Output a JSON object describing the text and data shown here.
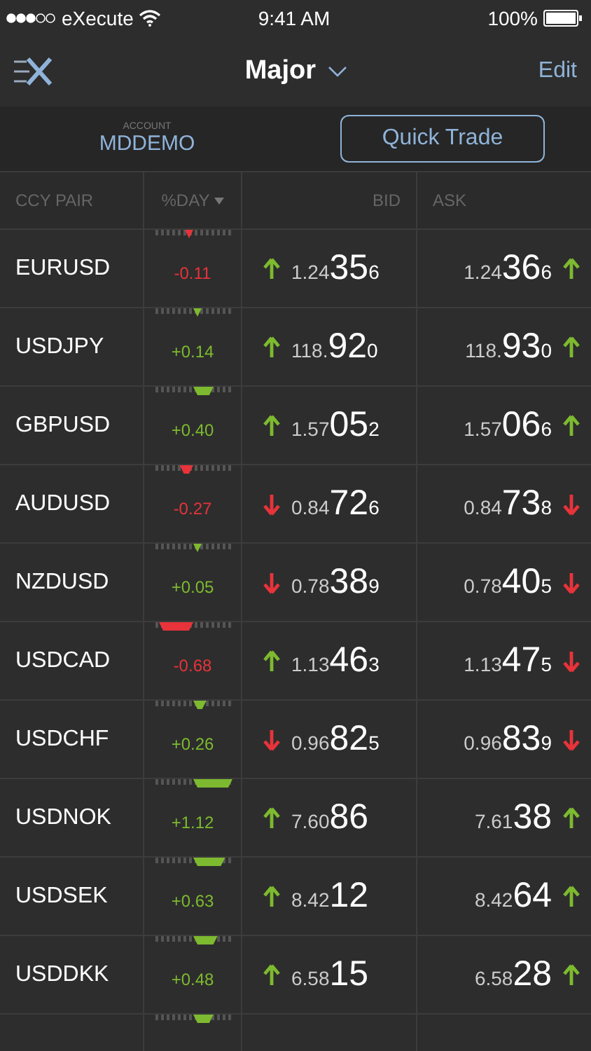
{
  "status_bar": {
    "carrier": "eXecute",
    "time": "9:41 AM",
    "battery": "100%"
  },
  "nav": {
    "title": "Major",
    "action": "Edit"
  },
  "account": {
    "label": "ACCOUNT",
    "name": "MDDEMO",
    "button": "Quick Trade"
  },
  "columns": [
    {
      "label": "CCY PAIR",
      "sorted": false
    },
    {
      "label": "%DAY",
      "sorted": true
    },
    {
      "label": "BID",
      "sorted": false
    },
    {
      "label": "ASK",
      "sorted": false
    }
  ],
  "rows": [
    {
      "pair": "EURUSD",
      "change": "-0.11",
      "negative": true,
      "bid": {
        "lead": "1.24",
        "big": "35",
        "tail": "6",
        "rising": true
      },
      "ask": {
        "lead": "1.24",
        "big": "36",
        "tail": "6",
        "rising": true
      }
    },
    {
      "pair": "USDJPY",
      "change": "+0.14",
      "negative": false,
      "bid": {
        "lead": "118.",
        "big": "92",
        "tail": "0",
        "rising": true
      },
      "ask": {
        "lead": "118.",
        "big": "93",
        "tail": "0",
        "rising": true
      }
    },
    {
      "pair": "GBPUSD",
      "change": "+0.40",
      "negative": false,
      "bid": {
        "lead": "1.57",
        "big": "05",
        "tail": "2",
        "rising": true
      },
      "ask": {
        "lead": "1.57",
        "big": "06",
        "tail": "6",
        "rising": true
      }
    },
    {
      "pair": "AUDUSD",
      "change": "-0.27",
      "negative": true,
      "bid": {
        "lead": "0.84",
        "big": "72",
        "tail": "6",
        "rising": false
      },
      "ask": {
        "lead": "0.84",
        "big": "73",
        "tail": "8",
        "rising": false
      }
    },
    {
      "pair": "NZDUSD",
      "change": "+0.05",
      "negative": false,
      "bid": {
        "lead": "0.78",
        "big": "38",
        "tail": "9",
        "rising": false
      },
      "ask": {
        "lead": "0.78",
        "big": "40",
        "tail": "5",
        "rising": false
      }
    },
    {
      "pair": "USDCAD",
      "change": "-0.68",
      "negative": true,
      "bid": {
        "lead": "1.13",
        "big": "46",
        "tail": "3",
        "rising": true
      },
      "ask": {
        "lead": "1.13",
        "big": "47",
        "tail": "5",
        "rising": false
      }
    },
    {
      "pair": "USDCHF",
      "change": "+0.26",
      "negative": false,
      "bid": {
        "lead": "0.96",
        "big": "82",
        "tail": "5",
        "rising": false
      },
      "ask": {
        "lead": "0.96",
        "big": "83",
        "tail": "9",
        "rising": false
      }
    },
    {
      "pair": "USDNOK",
      "change": "+1.12",
      "negative": false,
      "bid": {
        "lead": "7.60",
        "big": "86",
        "rising": true
      },
      "ask": {
        "lead": "7.61",
        "big": "38",
        "rising": true
      }
    },
    {
      "pair": "USDSEK",
      "change": "+0.63",
      "negative": false,
      "bid": {
        "lead": "8.42",
        "big": "12",
        "rising": true
      },
      "ask": {
        "lead": "8.42",
        "big": "64",
        "rising": true
      }
    },
    {
      "pair": "USDDKK",
      "change": "+0.48",
      "negative": false,
      "bid": {
        "lead": "6.58",
        "big": "15",
        "rising": true
      },
      "ask": {
        "lead": "6.58",
        "big": "28",
        "rising": true
      }
    },
    {
      "negative": false
    }
  ]
}
